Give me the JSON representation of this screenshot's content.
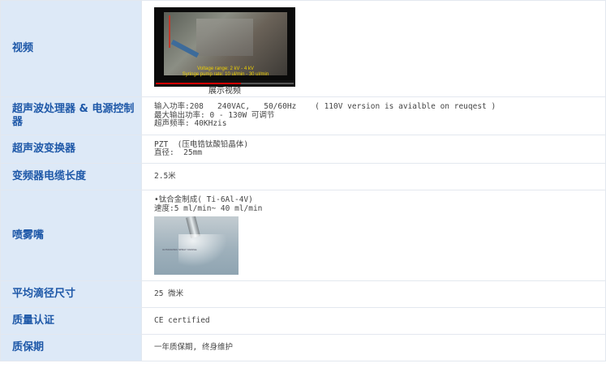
{
  "rows": [
    {
      "label": "视频",
      "video": {
        "caption_line1": "Voltage range: 2 kV - 4 kV",
        "caption_line2": "Syringe pump rate: 10 ul/min - 30 ul/min",
        "progress_fraction": 0.62,
        "description": "展示视频"
      }
    },
    {
      "label": "超声波处理器 & 电源控制器",
      "lines": [
        "输入功率:208   240VAC,   50/60Hz    ( 110V version is avialble on reuqest )",
        "最大输出功率: 0 - 130W 可调节",
        "超声频率: 40KHzis"
      ]
    },
    {
      "label": "超声波变换器",
      "lines": [
        "PZT  (压电锆钛酸铅晶体)",
        "直径:  25mm"
      ]
    },
    {
      "label": "变频器电缆长度",
      "lines": [
        "2.5米"
      ]
    },
    {
      "label": "喷雾嘴",
      "lines": [
        "•钛合金制成( Ti-6Al-4V)",
        "速度:5 ml/min~ 40 ml/min"
      ],
      "photo_label": "ULTRASONIC SPRAY NOZZLE"
    },
    {
      "label": "平均滴径尺寸",
      "lines": [
        "25 微米"
      ]
    },
    {
      "label": "质量认证",
      "lines": [
        "CE certified"
      ]
    },
    {
      "label": "质保期",
      "lines": [
        "一年质保期, 终身维护"
      ]
    }
  ],
  "colors": {
    "label_bg": "#dde9f7",
    "label_text": "#1e58a8",
    "border": "#e3e8ef",
    "progress": "#d20000"
  }
}
